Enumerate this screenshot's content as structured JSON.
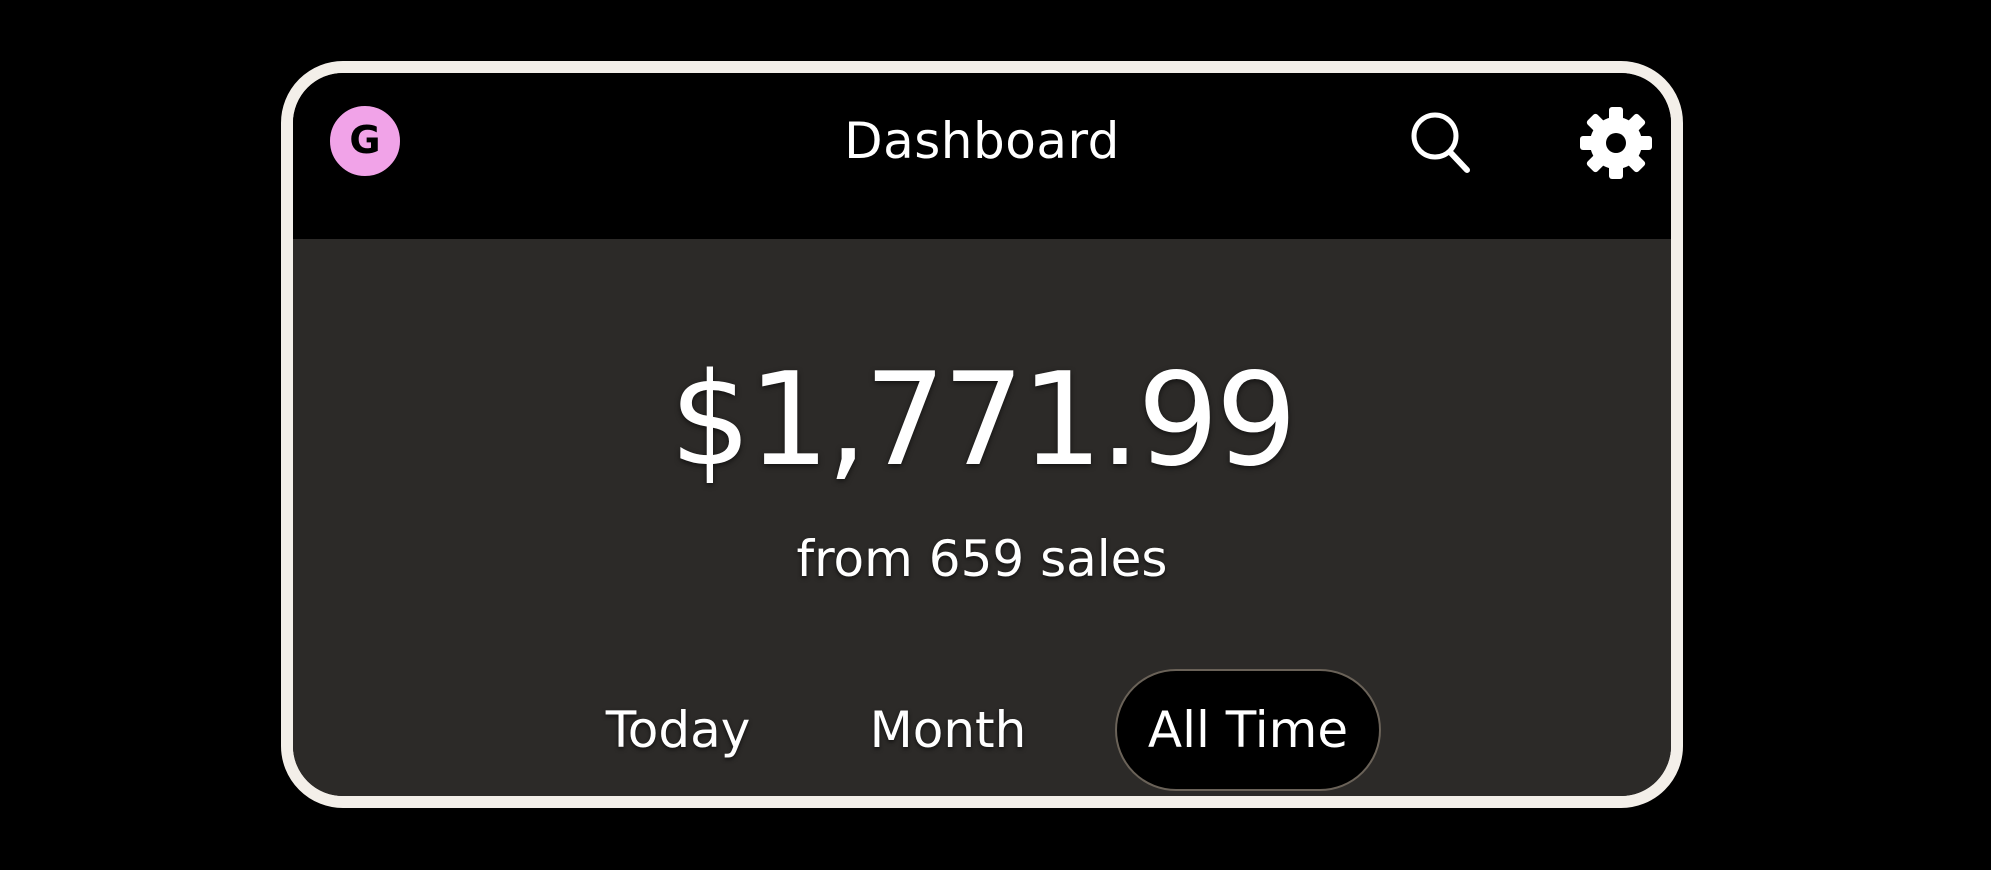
{
  "app": {
    "title": "Dashboard",
    "logo_letter": "G",
    "logo_color": "#f1a3e8",
    "frame_color": "#f3efe9",
    "panel_color": "#2c2a28"
  },
  "header": {
    "search_icon": "search-icon",
    "settings_icon": "gear-icon"
  },
  "summary": {
    "amount": "$1,771.99",
    "subtitle": "from 659 sales"
  },
  "tabs": [
    {
      "label": "Today",
      "selected": false
    },
    {
      "label": "Month",
      "selected": false
    },
    {
      "label": "All Time",
      "selected": true
    }
  ]
}
